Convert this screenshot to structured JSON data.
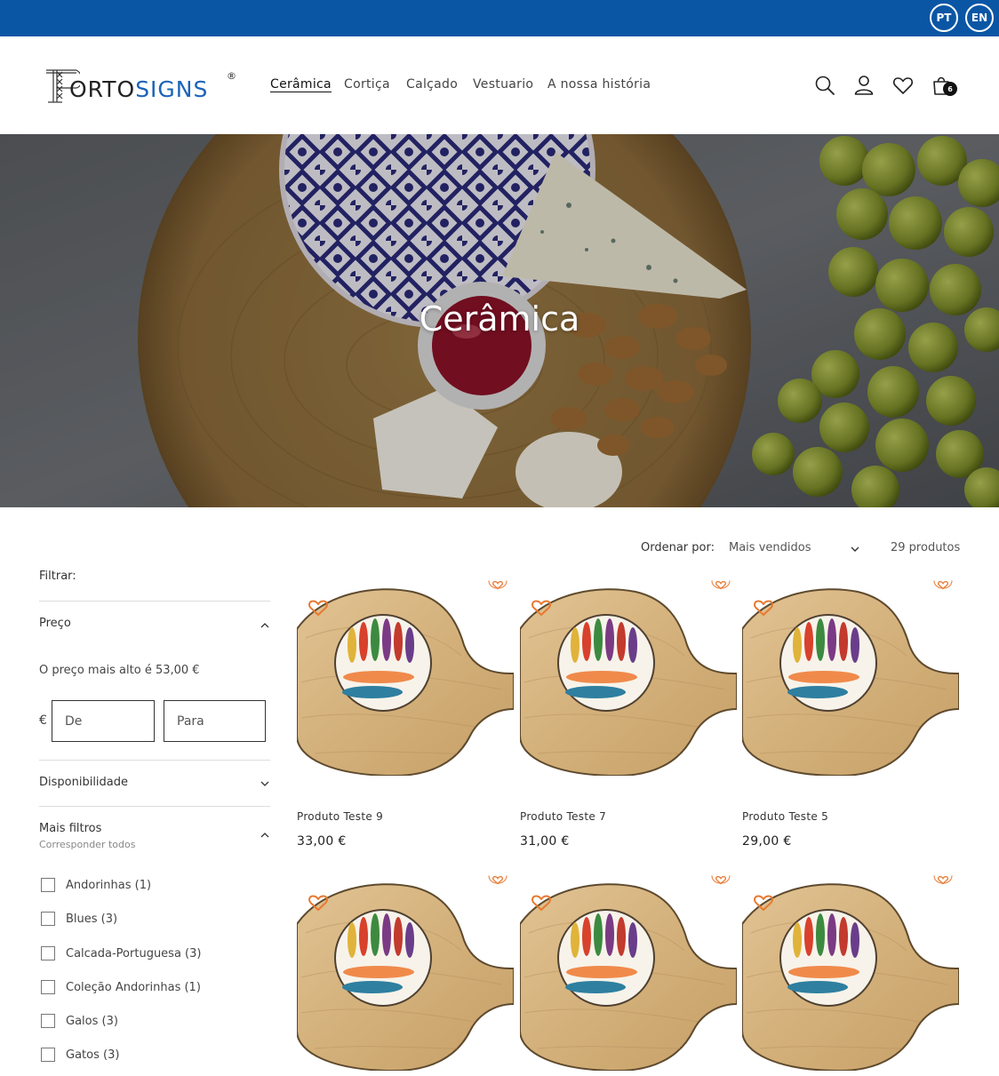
{
  "topbar": {
    "languages": [
      "PT",
      "EN"
    ],
    "color": "#0a56a5"
  },
  "brand": {
    "logo_part1": "ORTO",
    "logo_part2": "SIGNS",
    "registered": "®"
  },
  "nav": {
    "items": [
      "Cerâmica",
      "Cortiça",
      "Calçado",
      "Vestuario",
      "A nossa história"
    ],
    "active": "Cerâmica"
  },
  "header_icons": [
    "search-icon",
    "account-icon",
    "heart-icon",
    "cart-icon"
  ],
  "cart": {
    "count": "6"
  },
  "hero": {
    "title": "Cerâmica"
  },
  "sort": {
    "label": "Ordenar por:",
    "selected": "Mais vendidos",
    "count": "29 produtos"
  },
  "filters": {
    "title": "Filtrar:",
    "price": {
      "label": "Preço",
      "max_text": "O preço mais alto é 53,00 €",
      "currency": "€",
      "from_placeholder": "De",
      "to_placeholder": "Para"
    },
    "availability": {
      "label": "Disponibilidade"
    },
    "more": {
      "label": "Mais filtros",
      "sublabel": "Corresponder todos",
      "options": [
        "Andorinhas (1)",
        "Blues (3)",
        "Calcada-Portuguesa (3)",
        "Coleção Andorinhas (1)",
        "Galos (3)",
        "Gatos (3)"
      ]
    }
  },
  "products": [
    {
      "name": "Produto Teste 9",
      "price": "33,00 €"
    },
    {
      "name": "Produto Teste 7",
      "price": "31,00 €"
    },
    {
      "name": "Produto Teste 5",
      "price": "29,00 €"
    },
    {
      "name": "",
      "price": ""
    },
    {
      "name": "",
      "price": ""
    },
    {
      "name": "",
      "price": ""
    }
  ],
  "colors": {
    "accent_orange": "#e8782f",
    "wood": "#d9b98b"
  }
}
